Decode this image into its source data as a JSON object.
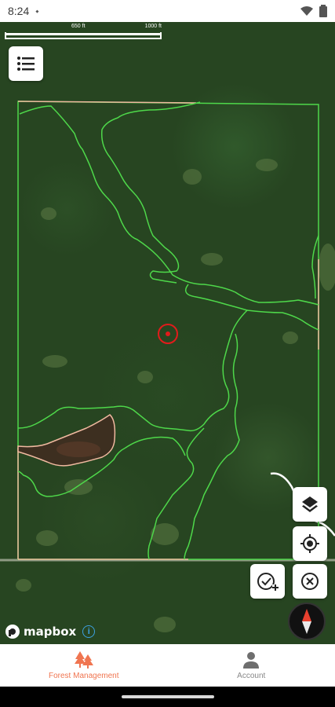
{
  "status_bar": {
    "time": "8:24",
    "icons": [
      "notification-dot-icon",
      "wifi-icon",
      "battery-icon"
    ]
  },
  "map": {
    "scale": {
      "mid_label": "650 ft",
      "end_label": "1000 ft"
    },
    "attribution": "mapbox",
    "target_color": "#e21b1b",
    "boundary_color": "#4ed84a",
    "pond_outline_color": "#f0b9a0"
  },
  "controls": {
    "menu_icon": "list-icon",
    "layers_icon": "layers-icon",
    "locate_icon": "crosshair-icon",
    "add_check_icon": "check-plus-icon",
    "cancel_icon": "close-circle-icon",
    "compass_icon": "compass-icon"
  },
  "bottom_nav": {
    "items": [
      {
        "label": "Forest Management",
        "icon": "trees-icon",
        "active": true
      },
      {
        "label": "Account",
        "icon": "person-icon",
        "active": false
      }
    ],
    "active_color": "#f07550"
  }
}
